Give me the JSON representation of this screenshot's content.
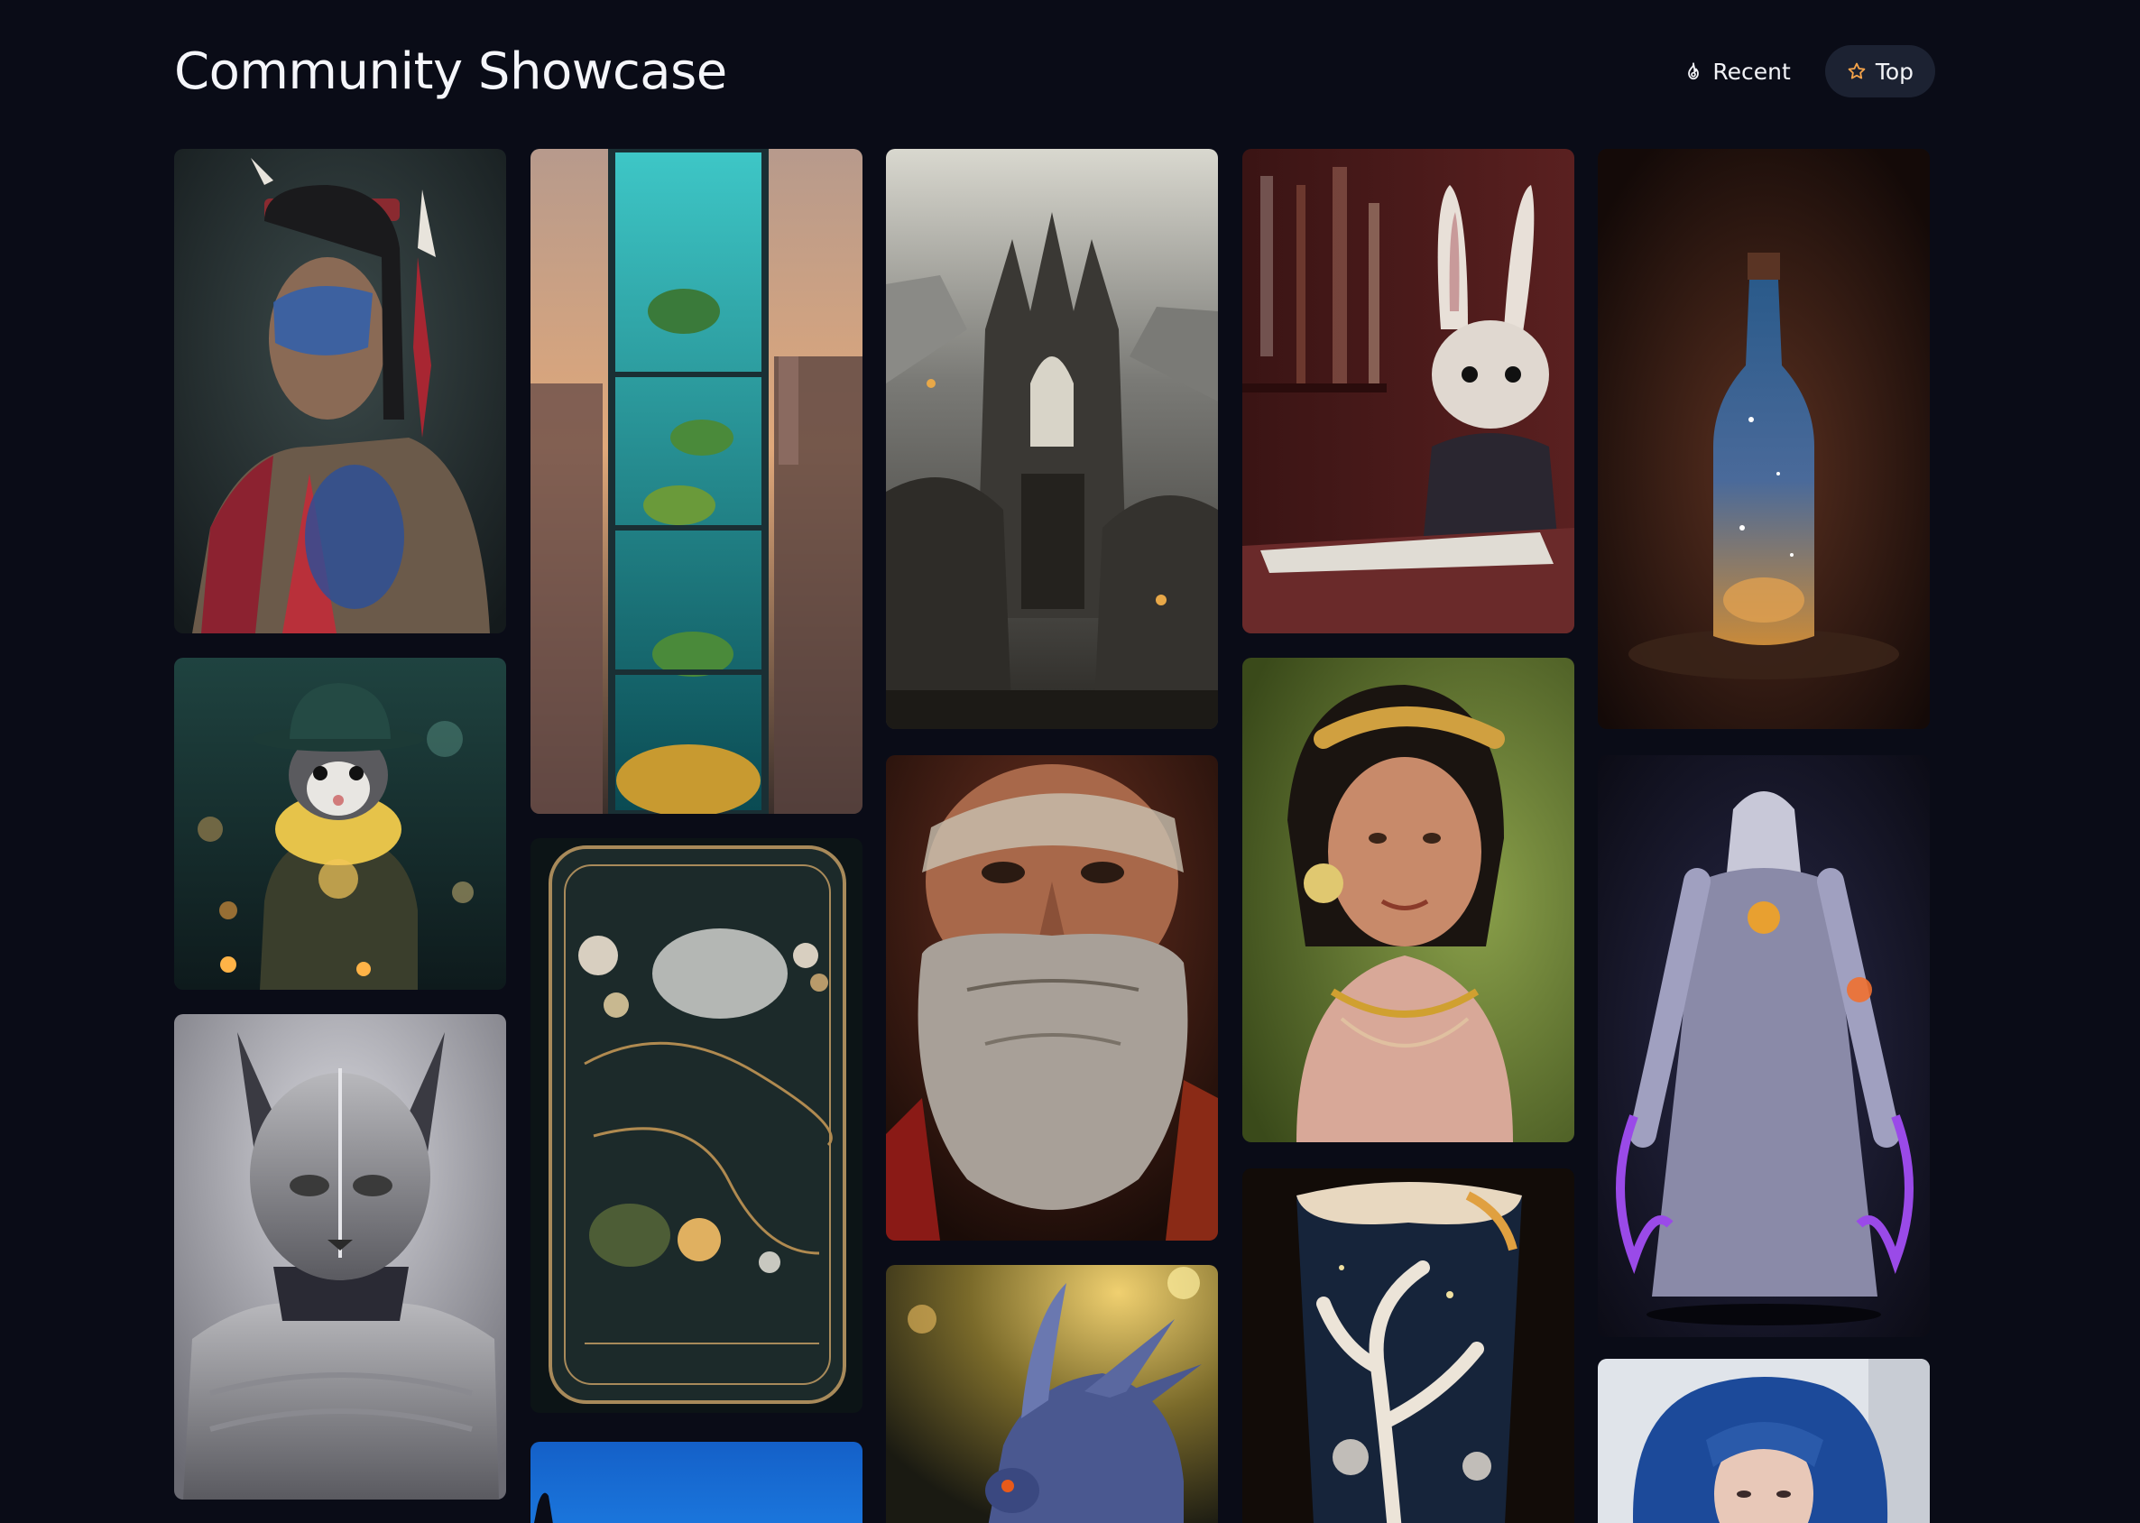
{
  "header": {
    "title": "Community Showcase",
    "sort_options": [
      {
        "label": "Recent",
        "icon": "fire-icon",
        "active": false
      },
      {
        "label": "Top",
        "icon": "star-icon",
        "active": true
      }
    ]
  },
  "colors": {
    "background": "#0a0c17",
    "active_pill": "#1c2232",
    "star_accent": "#f5a34a"
  },
  "gallery": {
    "columns": [
      [
        {
          "subject": "tribal-elder-portrait"
        },
        {
          "subject": "ferret-in-hat"
        },
        {
          "subject": "armored-cat-knight"
        }
      ],
      [
        {
          "subject": "aquarium-skyscraper"
        },
        {
          "subject": "ornate-fantasy-map"
        },
        {
          "subject": "blue-sky"
        }
      ],
      [
        {
          "subject": "gothic-cathedral-cliffs"
        },
        {
          "subject": "bearded-old-man"
        },
        {
          "subject": "blue-dragon"
        }
      ],
      [
        {
          "subject": "rabbit-writing-at-desk"
        },
        {
          "subject": "woman-with-golden-braid"
        },
        {
          "subject": "carved-porcelain-vase"
        }
      ],
      [
        {
          "subject": "galaxy-in-bottle"
        },
        {
          "subject": "glowing-ghost-wizard"
        },
        {
          "subject": "blue-haired-woman"
        }
      ]
    ]
  }
}
